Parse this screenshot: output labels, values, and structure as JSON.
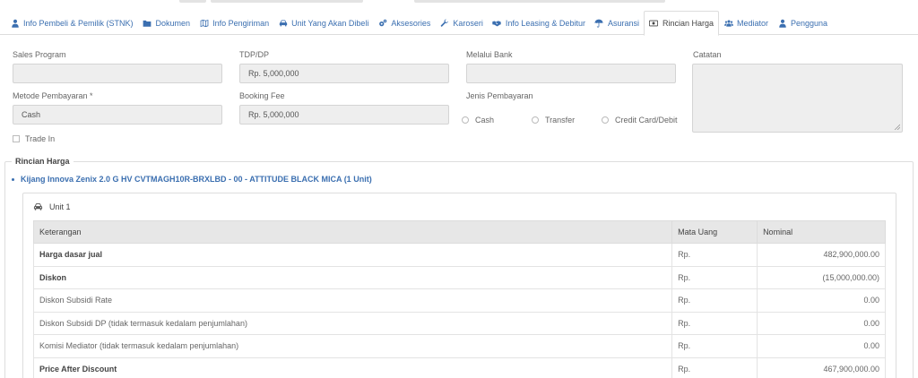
{
  "tabs": [
    {
      "label": "Info Pembeli & Pemilik (STNK)",
      "icon": "user-icon",
      "active": false
    },
    {
      "label": "Dokumen",
      "icon": "folder-icon",
      "active": false
    },
    {
      "label": "Info Pengiriman",
      "icon": "map-icon",
      "active": false
    },
    {
      "label": "Unit Yang Akan Dibeli",
      "icon": "car-icon",
      "active": false
    },
    {
      "label": "Aksesories",
      "icon": "cogs-icon",
      "active": false
    },
    {
      "label": "Karoseri",
      "icon": "wrench-icon",
      "active": false
    },
    {
      "label": "Info Leasing & Debitur",
      "icon": "handshake-icon",
      "active": false
    },
    {
      "label": "Asuransi",
      "icon": "umbrella-icon",
      "active": false
    },
    {
      "label": "Rincian Harga",
      "icon": "money-icon",
      "active": true
    },
    {
      "label": "Mediator",
      "icon": "users-icon",
      "active": false
    },
    {
      "label": "Pengguna",
      "icon": "user-icon",
      "active": false
    }
  ],
  "form": {
    "sales_program": {
      "label": "Sales Program",
      "value": ""
    },
    "tdp_dp": {
      "label": "TDP/DP",
      "value": "Rp. 5,000,000"
    },
    "melalui_bank": {
      "label": "Melalui Bank",
      "value": ""
    },
    "catatan": {
      "label": "Catatan",
      "value": ""
    },
    "metode_pembayaran": {
      "label": "Metode Pembayaran *",
      "value": "Cash"
    },
    "booking_fee": {
      "label": "Booking Fee",
      "value": "Rp. 5,000,000"
    },
    "jenis_pembayaran": {
      "label": "Jenis Pembayaran",
      "options": [
        "Cash",
        "Transfer",
        "Credit Card/Debit"
      ]
    },
    "trade_in": {
      "label": "Trade In",
      "checked": false
    }
  },
  "rincian": {
    "legend": "Rincian Harga",
    "item_title": "Kijang Innova Zenix 2.0 G HV CVTMAGH10R-BRXLBD - 00 - ATTITUDE BLACK MICA  (1 Unit)",
    "unit_title": "Unit 1",
    "columns": [
      "Keterangan",
      "Mata Uang",
      "Nominal"
    ],
    "rows": [
      {
        "keterangan": "Harga dasar jual",
        "mata_uang": "Rp.",
        "nominal": "482,900,000.00",
        "bold": true
      },
      {
        "keterangan": "Diskon",
        "mata_uang": "Rp.",
        "nominal": "(15,000,000.00)",
        "bold": true
      },
      {
        "keterangan": "Diskon Subsidi Rate",
        "mata_uang": "Rp.",
        "nominal": "0.00",
        "bold": false
      },
      {
        "keterangan": "Diskon Subsidi DP (tidak termasuk kedalam penjumlahan)",
        "mata_uang": "Rp.",
        "nominal": "0.00",
        "bold": false
      },
      {
        "keterangan": "Komisi Mediator (tidak termasuk kedalam penjumlahan)",
        "mata_uang": "Rp.",
        "nominal": "0.00",
        "bold": false
      },
      {
        "keterangan": "Price After Discount",
        "mata_uang": "Rp.",
        "nominal": "467,900,000.00",
        "bold": true
      }
    ]
  },
  "colors": {
    "link": "#3b6fb0",
    "field_bg": "#eeeeee",
    "header_bg": "#e7e7e7"
  }
}
